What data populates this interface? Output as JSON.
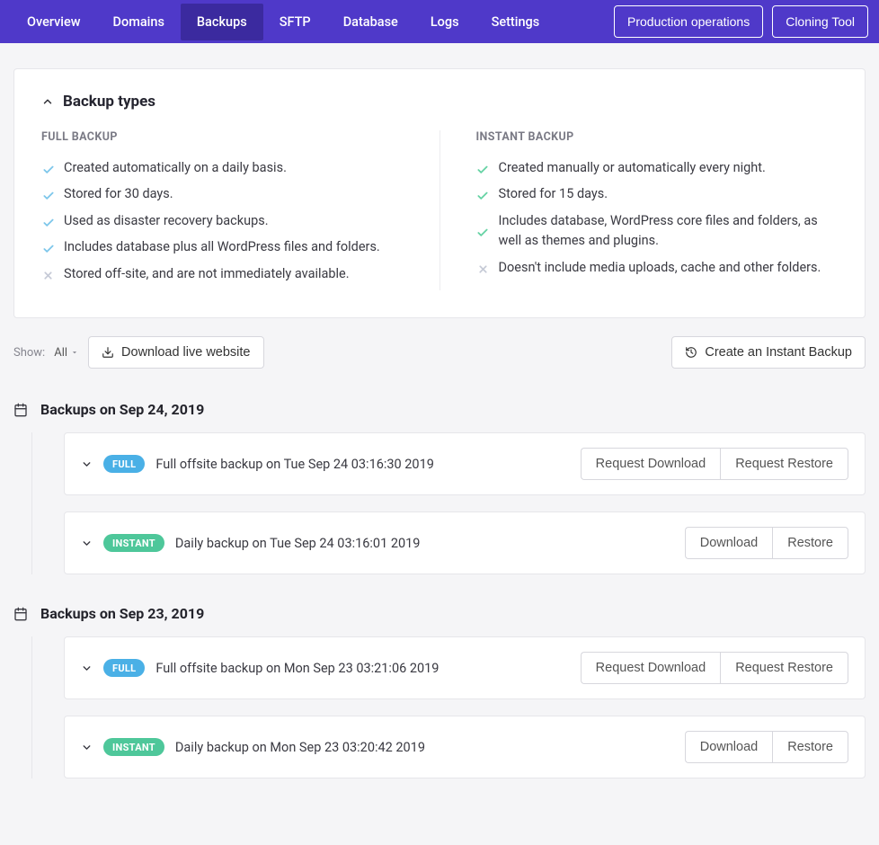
{
  "nav": {
    "tabs": [
      "Overview",
      "Domains",
      "Backups",
      "SFTP",
      "Database",
      "Logs",
      "Settings"
    ],
    "active": "Backups",
    "actions": {
      "prod_ops": "Production operations",
      "cloning": "Cloning Tool"
    }
  },
  "panel": {
    "title": "Backup types",
    "full": {
      "heading": "FULL BACKUP",
      "items": [
        {
          "ok": true,
          "text": "Created automatically on a daily basis."
        },
        {
          "ok": true,
          "text": "Stored for 30 days."
        },
        {
          "ok": true,
          "text": "Used as disaster recovery backups."
        },
        {
          "ok": true,
          "text": "Includes database plus all WordPress files and folders."
        },
        {
          "ok": false,
          "text": "Stored off-site, and are not immediately available."
        }
      ]
    },
    "instant": {
      "heading": "INSTANT BACKUP",
      "items": [
        {
          "ok": true,
          "text": "Created manually or automatically every night."
        },
        {
          "ok": true,
          "text": "Stored for 15 days."
        },
        {
          "ok": true,
          "text": "Includes database, WordPress core files and folders, as well as themes and plugins."
        },
        {
          "ok": false,
          "text": "Doesn't include media uploads, cache and other folders."
        }
      ]
    }
  },
  "toolbar": {
    "show_label": "Show:",
    "filter": "All",
    "download_live": "Download live website",
    "create_instant": "Create an Instant Backup"
  },
  "labels": {
    "request_download": "Request Download",
    "request_restore": "Request Restore",
    "download": "Download",
    "restore": "Restore",
    "full_badge": "FULL",
    "instant_badge": "INSTANT"
  },
  "groups": [
    {
      "title": "Backups on Sep 24, 2019",
      "entries": [
        {
          "type": "full",
          "desc": "Full offsite backup on Tue Sep 24 03:16:30 2019"
        },
        {
          "type": "instant",
          "desc": "Daily backup on Tue Sep 24 03:16:01 2019"
        }
      ]
    },
    {
      "title": "Backups on Sep 23, 2019",
      "entries": [
        {
          "type": "full",
          "desc": "Full offsite backup on Mon Sep 23 03:21:06 2019"
        },
        {
          "type": "instant",
          "desc": "Daily backup on Mon Sep 23 03:20:42 2019"
        }
      ]
    }
  ],
  "colors": {
    "check_full": "#7cc6ea",
    "check_inst": "#64d2a3",
    "cross": "#c5c9d6"
  }
}
